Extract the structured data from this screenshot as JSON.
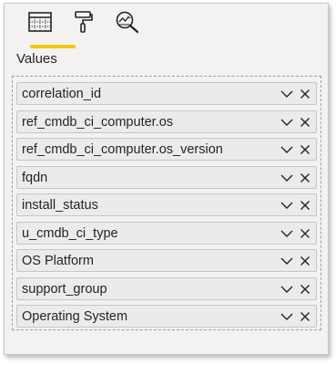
{
  "tabs": [
    {
      "name": "build-visual",
      "icon": "table-grid-icon",
      "active": true
    },
    {
      "name": "format",
      "icon": "paint-roller-icon",
      "active": false
    },
    {
      "name": "analytics",
      "icon": "magnifier-chart-icon",
      "active": false
    }
  ],
  "section": {
    "label": "Values"
  },
  "fields": [
    {
      "label": "correlation_id"
    },
    {
      "label": "ref_cmdb_ci_computer.os"
    },
    {
      "label": "ref_cmdb_ci_computer.os_version"
    },
    {
      "label": "fqdn"
    },
    {
      "label": "install_status"
    },
    {
      "label": "u_cmdb_ci_type"
    },
    {
      "label": "OS Platform"
    },
    {
      "label": "support_group"
    },
    {
      "label": "Operating System"
    }
  ],
  "colors": {
    "accent": "#f2c811",
    "panel": "#f3f2f1",
    "field": "#edebe9"
  }
}
